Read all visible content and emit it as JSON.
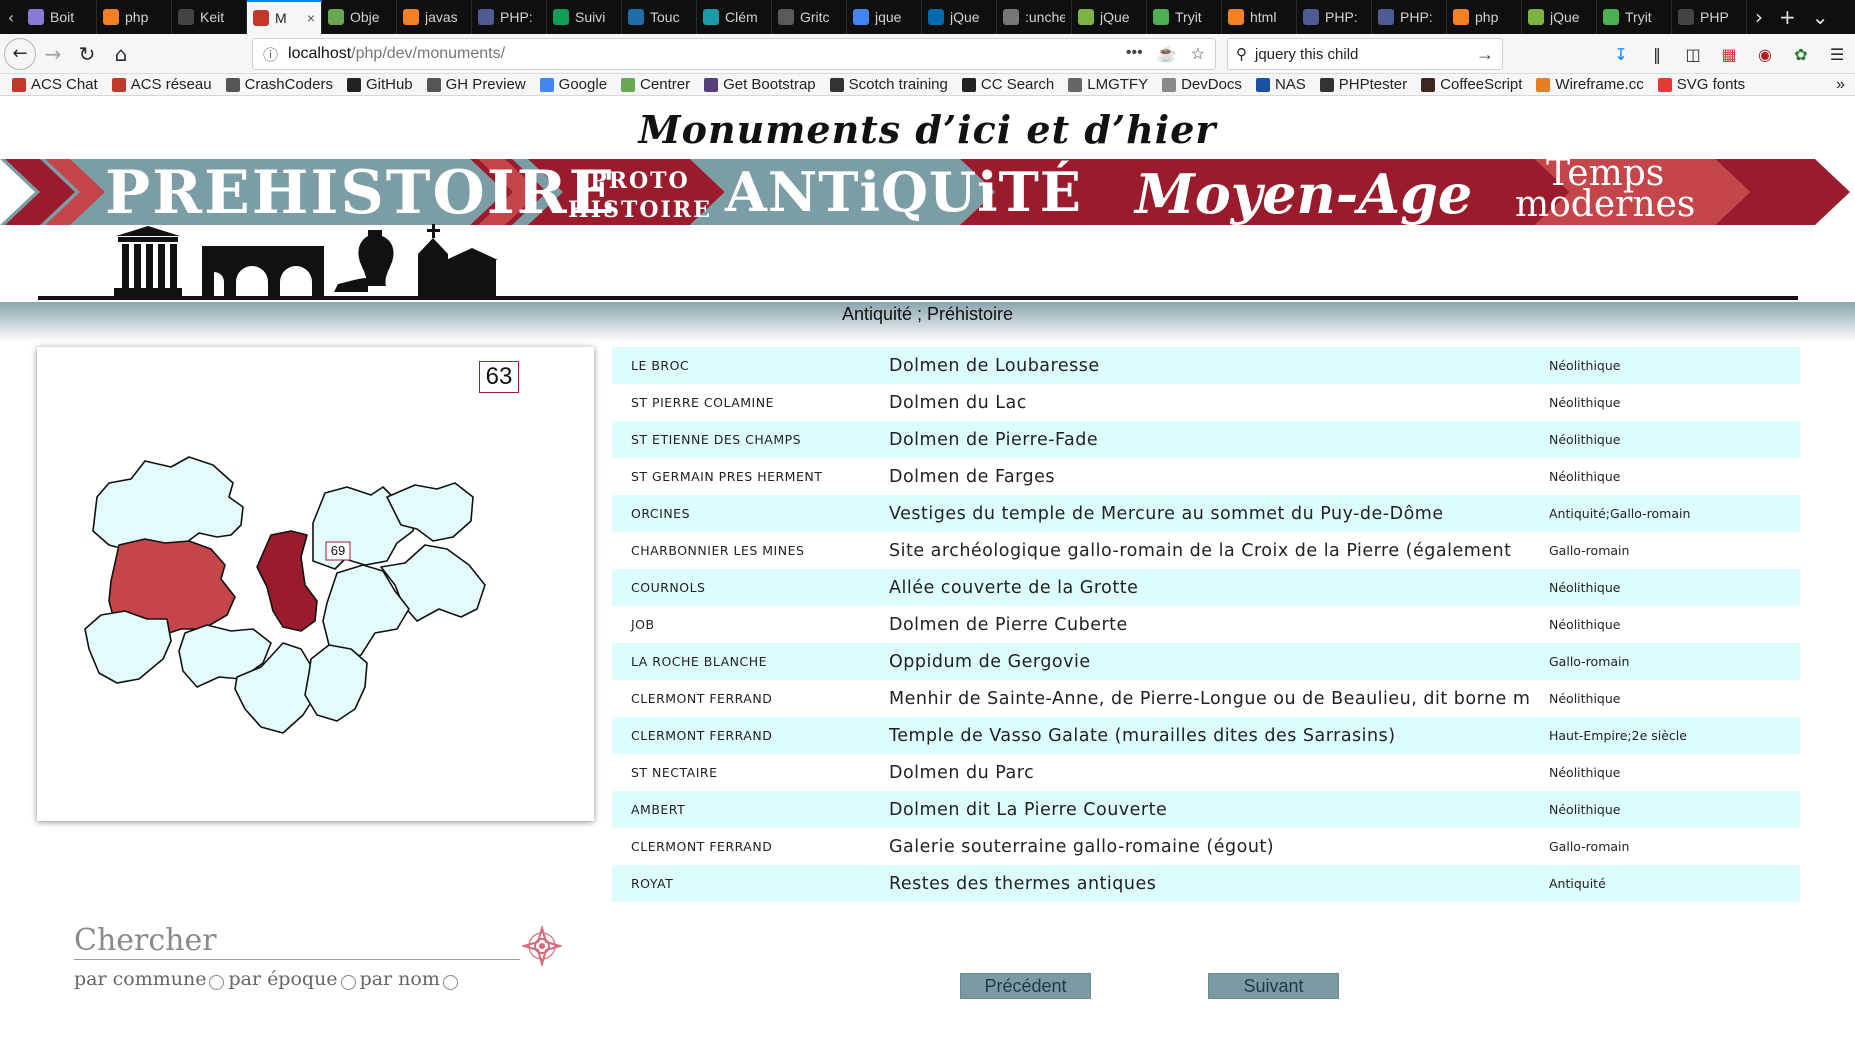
{
  "browser": {
    "tabs": [
      {
        "label": "Boit",
        "icon": "lock-icon",
        "color": "#8a7ad8"
      },
      {
        "label": "php",
        "icon": "stackoverflow-icon",
        "color": "#f48024"
      },
      {
        "label": "Keit",
        "icon": "github-icon",
        "color": "#444444"
      },
      {
        "label": "M",
        "icon": "monuments-icon",
        "color": "#c0392b",
        "active": true
      },
      {
        "label": "Obje",
        "icon": "leaf-icon",
        "color": "#6aa84f"
      },
      {
        "label": "javas",
        "icon": "stackoverflow-icon",
        "color": "#f48024"
      },
      {
        "label": "PHP:",
        "icon": "php-icon",
        "color": "#4f5b93"
      },
      {
        "label": "Suivi",
        "icon": "sheet-icon",
        "color": "#0f9d58"
      },
      {
        "label": "Touc",
        "icon": "touch-icon",
        "color": "#1e6fa8"
      },
      {
        "label": "Clém",
        "icon": "clem-icon",
        "color": "#1b9aaa"
      },
      {
        "label": "Gritc",
        "icon": "chart-icon",
        "color": "#5a5a5a"
      },
      {
        "label": "jque",
        "icon": "google-icon",
        "color": "#4285f4"
      },
      {
        "label": "jQue",
        "icon": "jquery-icon",
        "color": "#0769ad"
      },
      {
        "label": ":unchec",
        "icon": "blank-icon",
        "color": "#777777"
      },
      {
        "label": "jQue",
        "icon": "wave-icon",
        "color": "#7cb342"
      },
      {
        "label": "Tryit",
        "icon": "wave-icon",
        "color": "#4caf50"
      },
      {
        "label": "html",
        "icon": "stackoverflow-icon",
        "color": "#f48024"
      },
      {
        "label": "PHP:",
        "icon": "php-icon",
        "color": "#4f5b93"
      },
      {
        "label": "PHP:",
        "icon": "php-icon",
        "color": "#4f5b93"
      },
      {
        "label": "php",
        "icon": "stackoverflow-icon",
        "color": "#f48024"
      },
      {
        "label": "jQue",
        "icon": "wave-icon",
        "color": "#7cb342"
      },
      {
        "label": "Tryit",
        "icon": "wave-icon",
        "color": "#4caf50"
      },
      {
        "label": "PHP",
        "icon": "github-icon",
        "color": "#444444"
      }
    ],
    "url_host": "localhost",
    "url_path": "/php/dev/monuments/",
    "search_text": "jquery this child",
    "bookmarks": [
      {
        "label": "ACS Chat",
        "color": "#c0392b"
      },
      {
        "label": "ACS réseau",
        "color": "#c0392b"
      },
      {
        "label": "CrashCoders",
        "color": "#555555"
      },
      {
        "label": "GitHub",
        "color": "#222222"
      },
      {
        "label": "GH Preview",
        "color": "#555555"
      },
      {
        "label": "Google",
        "color": "#4285f4"
      },
      {
        "label": "Centrer",
        "color": "#6aa84f"
      },
      {
        "label": "Get Bootstrap",
        "color": "#563d7c"
      },
      {
        "label": "Scotch training",
        "color": "#333333"
      },
      {
        "label": "CC Search",
        "color": "#222222"
      },
      {
        "label": "LMGTFY",
        "color": "#666666"
      },
      {
        "label": "DevDocs",
        "color": "#888888"
      },
      {
        "label": "NAS",
        "color": "#1a4fa3"
      },
      {
        "label": "PHPtester",
        "color": "#333333"
      },
      {
        "label": "CoffeeScript",
        "color": "#3e2723"
      },
      {
        "label": "Wireframe.cc",
        "color": "#e67e22"
      },
      {
        "label": "SVG fonts",
        "color": "#e53935"
      }
    ]
  },
  "site": {
    "title": "Monuments d’ici et d’hier",
    "eras": {
      "prehistoire": "PREHISTOIRE",
      "proto_line1": "PROTO",
      "proto_line2": "HISTOIRE",
      "antiquite": "ANTiQUiTÉ",
      "moyen_age": "Moyen-Age",
      "temps_line1": "Temps",
      "temps_line2": "modernes"
    },
    "colors": {
      "era_teal": "#7b9ea6",
      "era_red": "#9a1b2c",
      "era_rose": "#c4454a",
      "row_highlight": "#ddfdfd",
      "pager_bg": "#7b9ba3"
    },
    "filter_line": "Antiquité ; Préhistoire"
  },
  "map": {
    "selected_dept": "63",
    "label_69": "69"
  },
  "results": [
    {
      "commune": "LE BROC",
      "nom": "Dolmen de Loubaresse",
      "epoque": "Néolithique"
    },
    {
      "commune": "ST PIERRE COLAMINE",
      "nom": "Dolmen du Lac",
      "epoque": "Néolithique"
    },
    {
      "commune": "ST ETIENNE DES CHAMPS",
      "nom": "Dolmen de Pierre-Fade",
      "epoque": "Néolithique"
    },
    {
      "commune": "ST GERMAIN PRES HERMENT",
      "nom": "Dolmen de Farges",
      "epoque": "Néolithique"
    },
    {
      "commune": "ORCINES",
      "nom": "Vestiges du temple de Mercure au sommet du Puy-de-Dôme",
      "epoque": "Antiquité;Gallo-romain"
    },
    {
      "commune": "CHARBONNIER LES MINES",
      "nom": "Site archéologique gallo-romain de la Croix de la Pierre (également",
      "epoque": "Gallo-romain"
    },
    {
      "commune": "COURNOLS",
      "nom": "Allée couverte de la Grotte",
      "epoque": "Néolithique"
    },
    {
      "commune": "JOB",
      "nom": "Dolmen de Pierre Cuberte",
      "epoque": "Néolithique"
    },
    {
      "commune": "LA ROCHE BLANCHE",
      "nom": "Oppidum de Gergovie",
      "epoque": "Gallo-romain"
    },
    {
      "commune": "CLERMONT FERRAND",
      "nom": "Menhir de Sainte-Anne, de Pierre-Longue ou de Beaulieu, dit borne m",
      "epoque": "Néolithique"
    },
    {
      "commune": "CLERMONT FERRAND",
      "nom": "Temple de Vasso Galate (murailles dites des Sarrasins)",
      "epoque": "Haut-Empire;2e siècle"
    },
    {
      "commune": "ST NECTAIRE",
      "nom": "Dolmen du Parc",
      "epoque": "Néolithique"
    },
    {
      "commune": "AMBERT",
      "nom": "Dolmen dit La Pierre Couverte",
      "epoque": "Néolithique"
    },
    {
      "commune": "CLERMONT FERRAND",
      "nom": "Galerie souterraine gallo-romaine (égout)",
      "epoque": "Gallo-romain"
    },
    {
      "commune": "ROYAT",
      "nom": "Restes des thermes antiques",
      "epoque": "Antiquité"
    }
  ],
  "search": {
    "placeholder": "Chercher",
    "mode_commune": "par commune",
    "mode_epoque": "par époque",
    "mode_nom": "par nom"
  },
  "pager": {
    "prev": "Précédent",
    "next": "Suivant"
  }
}
